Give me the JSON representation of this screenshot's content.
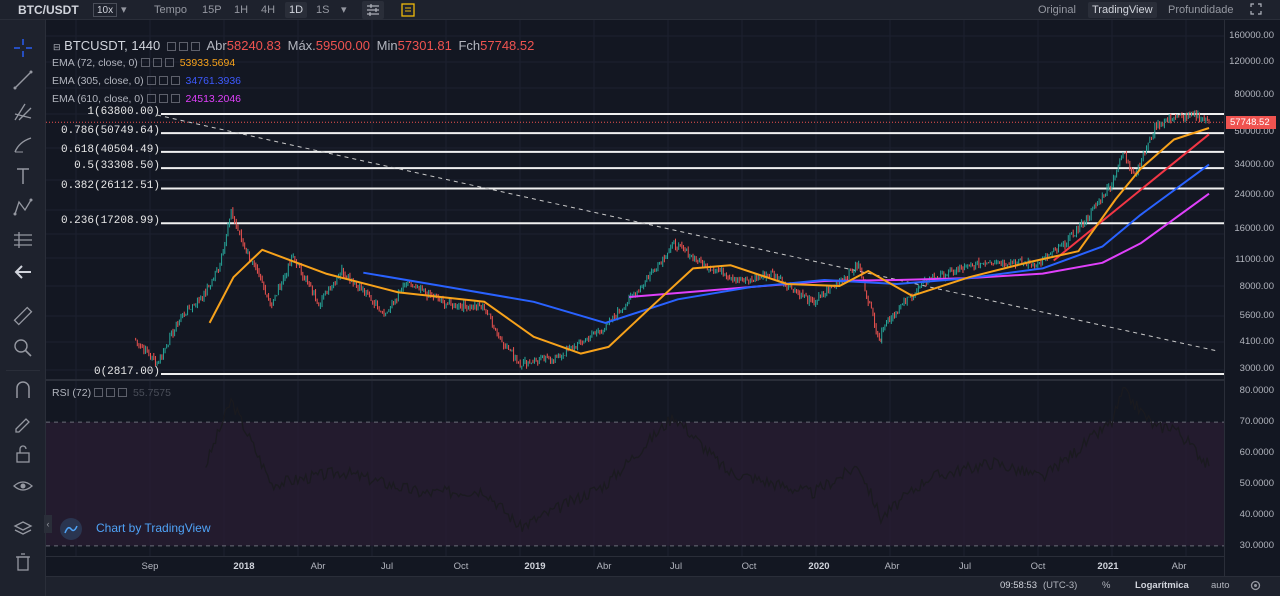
{
  "toolbar": {
    "symbol": "BTC/USDT",
    "leverage": "10x",
    "tempo": "Tempo",
    "intervals": [
      "15P",
      "1H",
      "4H",
      "1D",
      "1S"
    ],
    "active_interval": "1D",
    "views": [
      "Original",
      "TradingView",
      "Profundidade"
    ],
    "active_view": "TradingView"
  },
  "legend": {
    "main": {
      "name": "BTCUSDT, 1440",
      "open_label": "Abr",
      "open": "58240.83",
      "high_label": "Máx.",
      "high": "59500.00",
      "low_label": "Min",
      "low": "57301.81",
      "close_label": "Fch",
      "close": "57748.52"
    },
    "ema72": {
      "name": "EMA (72, close, 0)",
      "value": "53933.5694",
      "color": "#f7a21b"
    },
    "ema305": {
      "name": "EMA (305, close, 0)",
      "value": "34761.3936",
      "color": "#2962ff"
    },
    "ema610": {
      "name": "EMA (610, close, 0)",
      "value": "24513.2046",
      "color": "#e040fb"
    },
    "rsi": {
      "name": "RSI (72)",
      "value": "55.7575"
    }
  },
  "fib_levels": [
    {
      "label": "1(63800.00)",
      "price": 63800
    },
    {
      "label": "0.786(50749.64)",
      "price": 50749.64
    },
    {
      "label": "0.618(40504.49)",
      "price": 40504.49
    },
    {
      "label": "0.5(33308.50)",
      "price": 33308.5
    },
    {
      "label": "0.382(26112.51)",
      "price": 26112.51
    },
    {
      "label": "0.236(17208.99)",
      "price": 17208.99
    },
    {
      "label": "0(2817.00)",
      "price": 2817
    }
  ],
  "price_axis": [
    "160000.00",
    "120000.00",
    "80000.00",
    "50000.00",
    "34000.00",
    "24000.00",
    "16000.00",
    "11000.00",
    "8000.00",
    "5600.00",
    "4100.00",
    "3000.00"
  ],
  "current_price": "57748.52",
  "rsi_axis": [
    "80.0000",
    "70.0000",
    "60.0000",
    "50.0000",
    "40.0000",
    "30.0000"
  ],
  "time_axis": [
    {
      "label": "Sep",
      "bold": false
    },
    {
      "label": "2018",
      "bold": true
    },
    {
      "label": "Abr",
      "bold": false
    },
    {
      "label": "Jul",
      "bold": false
    },
    {
      "label": "Oct",
      "bold": false
    },
    {
      "label": "2019",
      "bold": true
    },
    {
      "label": "Abr",
      "bold": false
    },
    {
      "label": "Jul",
      "bold": false
    },
    {
      "label": "Oct",
      "bold": false
    },
    {
      "label": "2020",
      "bold": true
    },
    {
      "label": "Abr",
      "bold": false
    },
    {
      "label": "Jul",
      "bold": false
    },
    {
      "label": "Oct",
      "bold": false
    },
    {
      "label": "2021",
      "bold": true
    },
    {
      "label": "Abr",
      "bold": false
    }
  ],
  "bottom": {
    "time": "09:58:53",
    "tz": "(UTC-3)",
    "percent": "%",
    "log": "Logarítmica",
    "auto": "auto"
  },
  "watermark": "Chart by TradingView",
  "chart_data": {
    "type": "line",
    "scale": "log",
    "x_range": [
      "2017-08",
      "2021-04"
    ],
    "price_series": [
      {
        "date": "2017-08-17",
        "close": 4300
      },
      {
        "date": "2017-09-15",
        "close": 3200
      },
      {
        "date": "2017-10-15",
        "close": 5600
      },
      {
        "date": "2017-11-15",
        "close": 7500
      },
      {
        "date": "2017-12-01",
        "close": 10000
      },
      {
        "date": "2017-12-17",
        "close": 19500
      },
      {
        "date": "2018-01-01",
        "close": 13500
      },
      {
        "date": "2018-02-06",
        "close": 6500
      },
      {
        "date": "2018-03-05",
        "close": 11500
      },
      {
        "date": "2018-04-06",
        "close": 6600
      },
      {
        "date": "2018-05-05",
        "close": 9800
      },
      {
        "date": "2018-06-29",
        "close": 5800
      },
      {
        "date": "2018-07-25",
        "close": 8300
      },
      {
        "date": "2018-09-15",
        "close": 6500
      },
      {
        "date": "2018-10-31",
        "close": 6300
      },
      {
        "date": "2018-11-20",
        "close": 4300
      },
      {
        "date": "2018-12-15",
        "close": 3200
      },
      {
        "date": "2019-02-01",
        "close": 3450
      },
      {
        "date": "2019-04-02",
        "close": 5000
      },
      {
        "date": "2019-05-15",
        "close": 8000
      },
      {
        "date": "2019-06-26",
        "close": 13500
      },
      {
        "date": "2019-08-01",
        "close": 10500
      },
      {
        "date": "2019-09-24",
        "close": 8500
      },
      {
        "date": "2019-10-26",
        "close": 9500
      },
      {
        "date": "2019-12-17",
        "close": 6600
      },
      {
        "date": "2020-02-13",
        "close": 10400
      },
      {
        "date": "2020-03-12",
        "close": 4000
      },
      {
        "date": "2020-03-13",
        "close": 5000
      },
      {
        "date": "2020-05-10",
        "close": 8800
      },
      {
        "date": "2020-07-27",
        "close": 11000
      },
      {
        "date": "2020-09-25",
        "close": 10500
      },
      {
        "date": "2020-10-25",
        "close": 13000
      },
      {
        "date": "2020-11-25",
        "close": 18000
      },
      {
        "date": "2020-12-27",
        "close": 28000
      },
      {
        "date": "2021-01-10",
        "close": 40000
      },
      {
        "date": "2021-01-25",
        "close": 31000
      },
      {
        "date": "2021-02-21",
        "close": 56000
      },
      {
        "date": "2021-03-13",
        "close": 61000
      },
      {
        "date": "2021-04-14",
        "close": 63000
      },
      {
        "date": "2021-04-28",
        "close": 57748.52
      }
    ],
    "ema72": [
      {
        "date": "2017-11-20",
        "value": 5200
      },
      {
        "date": "2017-12-20",
        "value": 9000
      },
      {
        "date": "2018-01-25",
        "value": 12500
      },
      {
        "date": "2018-04-15",
        "value": 9400
      },
      {
        "date": "2018-07-15",
        "value": 7500
      },
      {
        "date": "2018-10-31",
        "value": 6700
      },
      {
        "date": "2019-01-01",
        "value": 4400
      },
      {
        "date": "2019-03-01",
        "value": 3600
      },
      {
        "date": "2019-04-05",
        "value": 3900
      },
      {
        "date": "2019-06-01",
        "value": 6500
      },
      {
        "date": "2019-07-20",
        "value": 10000
      },
      {
        "date": "2019-09-05",
        "value": 10400
      },
      {
        "date": "2019-11-15",
        "value": 8300
      },
      {
        "date": "2020-01-20",
        "value": 8100
      },
      {
        "date": "2020-02-25",
        "value": 9700
      },
      {
        "date": "2020-04-20",
        "value": 7200
      },
      {
        "date": "2020-07-01",
        "value": 9000
      },
      {
        "date": "2020-09-15",
        "value": 10800
      },
      {
        "date": "2020-11-15",
        "value": 12300
      },
      {
        "date": "2021-01-01",
        "value": 23000
      },
      {
        "date": "2021-02-01",
        "value": 33000
      },
      {
        "date": "2021-03-15",
        "value": 47000
      },
      {
        "date": "2021-04-28",
        "value": 53933.57
      }
    ],
    "ema305": [
      {
        "date": "2018-06-01",
        "value": 9500
      },
      {
        "date": "2018-09-15",
        "value": 8000
      },
      {
        "date": "2019-01-01",
        "value": 6700
      },
      {
        "date": "2019-04-01",
        "value": 5200
      },
      {
        "date": "2019-07-01",
        "value": 6900
      },
      {
        "date": "2019-10-01",
        "value": 8000
      },
      {
        "date": "2020-01-01",
        "value": 8700
      },
      {
        "date": "2020-04-01",
        "value": 8300
      },
      {
        "date": "2020-07-01",
        "value": 8900
      },
      {
        "date": "2020-10-01",
        "value": 10000
      },
      {
        "date": "2020-12-15",
        "value": 13000
      },
      {
        "date": "2021-02-01",
        "value": 19000
      },
      {
        "date": "2021-04-28",
        "value": 34761.39
      }
    ],
    "ema610": [
      {
        "date": "2019-05-01",
        "value": 7100
      },
      {
        "date": "2019-10-01",
        "value": 8000
      },
      {
        "date": "2020-01-01",
        "value": 8600
      },
      {
        "date": "2020-04-01",
        "value": 8700
      },
      {
        "date": "2020-07-01",
        "value": 8900
      },
      {
        "date": "2020-10-01",
        "value": 9400
      },
      {
        "date": "2020-12-15",
        "value": 10700
      },
      {
        "date": "2021-02-01",
        "value": 13500
      },
      {
        "date": "2021-04-28",
        "value": 24513.2
      }
    ],
    "trendline_red": [
      {
        "date": "2020-10-15",
        "value": 11000
      },
      {
        "date": "2021-04-28",
        "value": 50000
      }
    ],
    "trendline_dashed": [
      {
        "date": "2017-09-15",
        "value": 63000
      },
      {
        "date": "2021-05-10",
        "value": 3700
      }
    ],
    "rsi": [
      {
        "date": "2017-11-15",
        "value": 56
      },
      {
        "date": "2017-12-17",
        "value": 77
      },
      {
        "date": "2018-02-06",
        "value": 50
      },
      {
        "date": "2018-05-05",
        "value": 54
      },
      {
        "date": "2018-08-15",
        "value": 47
      },
      {
        "date": "2018-10-31",
        "value": 48
      },
      {
        "date": "2018-12-15",
        "value": 36
      },
      {
        "date": "2019-04-02",
        "value": 50
      },
      {
        "date": "2019-06-26",
        "value": 72
      },
      {
        "date": "2019-09-01",
        "value": 54
      },
      {
        "date": "2019-12-17",
        "value": 47
      },
      {
        "date": "2020-02-13",
        "value": 56
      },
      {
        "date": "2020-03-12",
        "value": 39
      },
      {
        "date": "2020-05-10",
        "value": 52
      },
      {
        "date": "2020-08-01",
        "value": 57
      },
      {
        "date": "2020-10-01",
        "value": 52
      },
      {
        "date": "2020-12-27",
        "value": 70
      },
      {
        "date": "2021-01-10",
        "value": 80
      },
      {
        "date": "2021-02-21",
        "value": 68
      },
      {
        "date": "2021-03-13",
        "value": 69
      },
      {
        "date": "2021-04-14",
        "value": 60
      },
      {
        "date": "2021-04-28",
        "value": 55.76
      }
    ],
    "rsi_range": [
      28,
      82
    ],
    "rsi_bands": [
      70,
      30
    ]
  }
}
